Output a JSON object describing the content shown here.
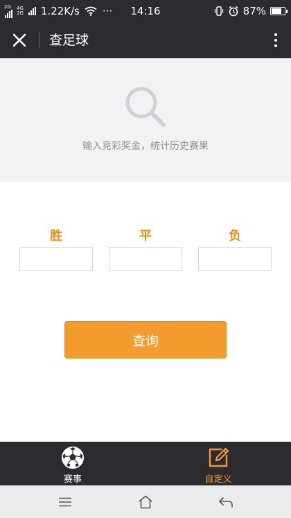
{
  "status_bar": {
    "sim1_label": "2G",
    "sim2_top": "4G",
    "sim2_bottom": "2G",
    "net_speed": "1.22K/s",
    "more": "···",
    "time": "14:16",
    "battery_text": "87%",
    "battery_level": 0.87
  },
  "header": {
    "title": "查足球"
  },
  "banner": {
    "hint": "输入竞彩奖金，统计历史赛果"
  },
  "odds": {
    "win_label": "胜",
    "draw_label": "平",
    "lose_label": "负",
    "win_value": "",
    "draw_value": "",
    "lose_value": ""
  },
  "actions": {
    "query_label": "查询"
  },
  "tabbar": {
    "matches_label": "赛事",
    "custom_label": "自定义"
  },
  "colors": {
    "accent": "#f39c2d",
    "accent_text": "#ee8d12",
    "dark_bar": "#2b2b30",
    "banner_bg": "#f2f2f4"
  },
  "icons": {
    "close": "close-icon",
    "more": "more-vertical-icon",
    "search": "search-icon",
    "soccer": "soccer-ball-icon",
    "edit": "edit-icon",
    "menu": "menu-icon",
    "home": "home-icon",
    "back": "back-icon"
  }
}
